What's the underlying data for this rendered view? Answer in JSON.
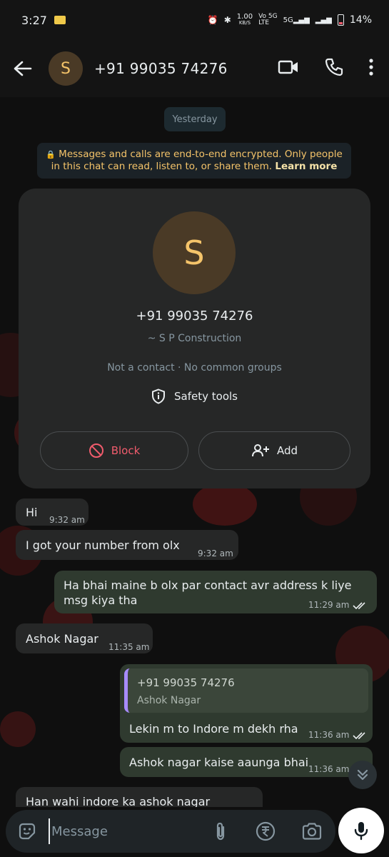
{
  "status_bar": {
    "time": "3:27",
    "speed": "1.00",
    "speed_unit": "KB/S",
    "net1": "Vo 5G",
    "net1b": "LTE",
    "net2": "5G",
    "battery": "14%"
  },
  "header": {
    "avatar_letter": "S",
    "title": "+91 99035 74276"
  },
  "chat": {
    "date_chip": "Yesterday",
    "encryption_notice": "Messages and calls are end-to-end encrypted. Only people in this chat can read, listen to, or share them.",
    "learn_more": "Learn more"
  },
  "contact_card": {
    "avatar_letter": "S",
    "phone": "+91 99035 74276",
    "name": "~ S P Construction",
    "info": "Not a contact · No common groups",
    "safety_tools": "Safety tools",
    "block_label": "Block",
    "add_label": "Add"
  },
  "messages": [
    {
      "text": "Hi",
      "time": "9:32 am"
    },
    {
      "text": "I got your number from olx",
      "time": "9:32 am"
    },
    {
      "line1": "Ha bhai maine b olx par contact avr address k liye",
      "line2": "msg kiya tha",
      "time": "11:29 am"
    },
    {
      "text": "Ashok Nagar",
      "time": "11:35 am"
    },
    {
      "quote_author": "+91 99035 74276",
      "quote_text": "Ashok Nagar",
      "text": "Lekin m to Indore m dekh rha",
      "time": "11:36 am"
    },
    {
      "text": "Ashok nagar kaise aaunga bhai",
      "time": "11:36 am"
    },
    {
      "text": "Han wahi indore ka ashok nagar"
    }
  ],
  "composer": {
    "placeholder": "Message"
  },
  "colors": {
    "accent": "#f5c46a",
    "outgoing_bubble": "#2f3a2f",
    "incoming_bubble": "#262727",
    "block_red": "#f15c6d",
    "read_tick": "#e9edef"
  }
}
